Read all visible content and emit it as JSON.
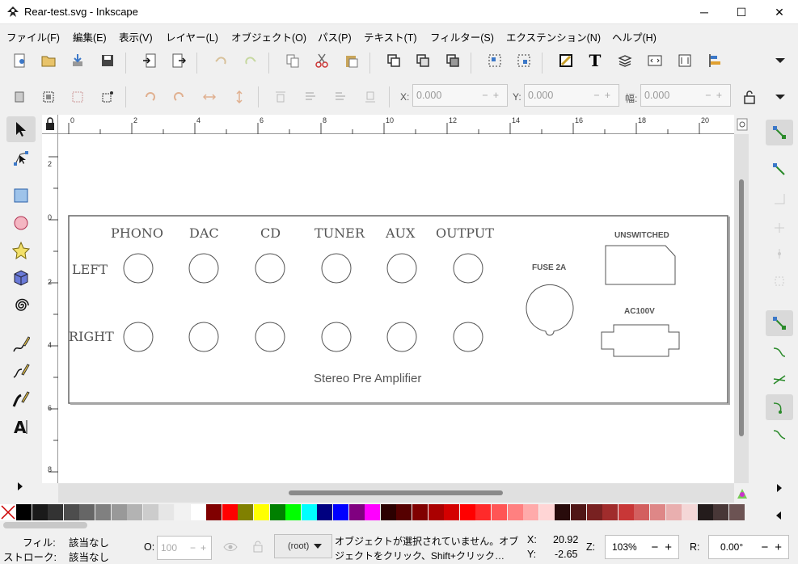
{
  "window": {
    "title": "Rear-test.svg - Inkscape",
    "controls": {
      "minimize": "─",
      "maximize": "☐",
      "close": "✕"
    }
  },
  "menu": [
    "ファイル(F)",
    "編集(E)",
    "表示(V)",
    "レイヤー(L)",
    "オブジェクト(O)",
    "パス(P)",
    "テキスト(T)",
    "フィルター(S)",
    "エクステンション(N)",
    "ヘルプ(H)"
  ],
  "toolbar_ctrl": {
    "x_label": "X:",
    "x_value": "0.000",
    "y_label": "Y:",
    "y_value": "0.000",
    "w_label": "幅:",
    "w_value": "0.000",
    "minus": "−",
    "plus": "+"
  },
  "rulers": {
    "h": [
      "0",
      "2",
      "4",
      "6",
      "8",
      "10",
      "12",
      "14",
      "16",
      "18",
      "20"
    ],
    "v": [
      "2",
      "0",
      "2",
      "4",
      "6",
      "8"
    ]
  },
  "drawing": {
    "inputs": [
      "PHONO",
      "DAC",
      "CD",
      "TUNER",
      "AUX",
      "OUTPUT"
    ],
    "left_label": "LEFT",
    "right_label": "RIGHT",
    "fuse_label": "FUSE 2A",
    "unswitched_label": "UNSWITCHED",
    "ac_label": "AC100V",
    "caption": "Stereo Pre Amplifier"
  },
  "status": {
    "fill_label": "フィル:",
    "fill_value": "該当なし",
    "stroke_label": "ストローク:",
    "stroke_value": "該当なし",
    "opacity_label": "O:",
    "opacity_value": "100",
    "layer_value": "(root)",
    "message_line1": "オブジェクトが選択されていません。オブ",
    "message_line2": "ジェクトをクリック、Shift+クリック…",
    "x_label": "X:",
    "x_value": "20.92",
    "y_label": "Y:",
    "y_value": "-2.65",
    "zoom_label": "Z:",
    "zoom_value": "103%",
    "rot_label": "R:",
    "rot_value": "0.00°"
  },
  "colors": {
    "accent": "#3c78c8",
    "palette": [
      "#000000",
      "#1a1a1a",
      "#333333",
      "#4d4d4d",
      "#666666",
      "#808080",
      "#999999",
      "#b3b3b3",
      "#cccccc",
      "#e6e6e6",
      "#f2f2f2",
      "#ffffff",
      "#800000",
      "#ff0000",
      "#808000",
      "#ffff00",
      "#008000",
      "#00ff00",
      "#00ffff",
      "#000080",
      "#0000ff",
      "#800080",
      "#ff00ff",
      "#2b0000",
      "#550000",
      "#800000",
      "#aa0000",
      "#d40000",
      "#ff0000",
      "#ff2a2a",
      "#ff5555",
      "#ff8080",
      "#ffaaaa",
      "#ffd5d5",
      "#280b0b",
      "#501616",
      "#782121",
      "#a02c2c",
      "#c83737",
      "#d35f5f",
      "#de8787",
      "#e9afaf",
      "#f4d7d7",
      "#241c1c",
      "#483737",
      "#6c5353"
    ]
  }
}
